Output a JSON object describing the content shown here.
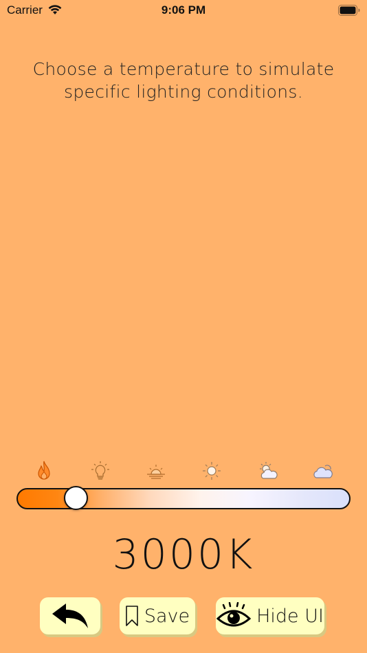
{
  "status_bar": {
    "carrier": "Carrier",
    "time": "9:06 PM",
    "battery_level": 1.0
  },
  "instruction": "Choose a temperature to simulate specific lighting conditions.",
  "temperature": {
    "value_label": "3000K",
    "slider_fraction": 0.18,
    "presets": [
      "fire-icon",
      "lightbulb-icon",
      "sunrise-icon",
      "sun-icon",
      "partly-cloudy-icon",
      "cloud-icon"
    ]
  },
  "buttons": {
    "back_icon": "back-arrow-icon",
    "save_label": "Save",
    "hide_label": "Hide UI"
  },
  "colors": {
    "background": "#ffb26b",
    "button_bg": "#ffffc1",
    "gradient_warm": "#ff7a00",
    "gradient_cool": "#d9e0fb"
  }
}
